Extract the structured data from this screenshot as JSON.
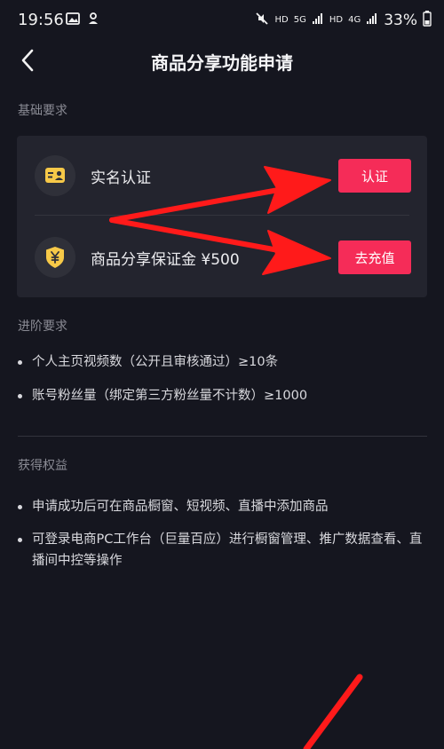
{
  "status_bar": {
    "time": "19:56",
    "network_labels": [
      "HD",
      "5G",
      "HD",
      "4G"
    ],
    "battery": "33%",
    "icons": [
      "image-icon",
      "notification-icon",
      "mute-icon",
      "signal-icon",
      "battery-icon"
    ]
  },
  "header": {
    "title": "商品分享功能申请"
  },
  "basic": {
    "section_title": "基础要求",
    "items": [
      {
        "label": "实名认证",
        "button": "认证",
        "icon": "id-card-icon"
      },
      {
        "label": "商品分享保证金 ¥500",
        "button": "去充值",
        "icon": "yen-shield-icon"
      }
    ]
  },
  "advanced": {
    "section_title": "进阶要求",
    "items": [
      "个人主页视频数（公开且审核通过）≥10条",
      "账号粉丝量（绑定第三方粉丝量不计数）≥1000"
    ]
  },
  "benefits": {
    "section_title": "获得权益",
    "items": [
      "申请成功后可在商品橱窗、短视频、直播中添加商品",
      "可登录电商PC工作台（巨量百应）进行橱窗管理、推广数据查看、直播间中控等操作"
    ]
  },
  "colors": {
    "background": "#15161f",
    "card": "#23242e",
    "accent": "#f52c58",
    "icon_yellow": "#f7c948",
    "annotation_red": "#ff1a1a"
  }
}
